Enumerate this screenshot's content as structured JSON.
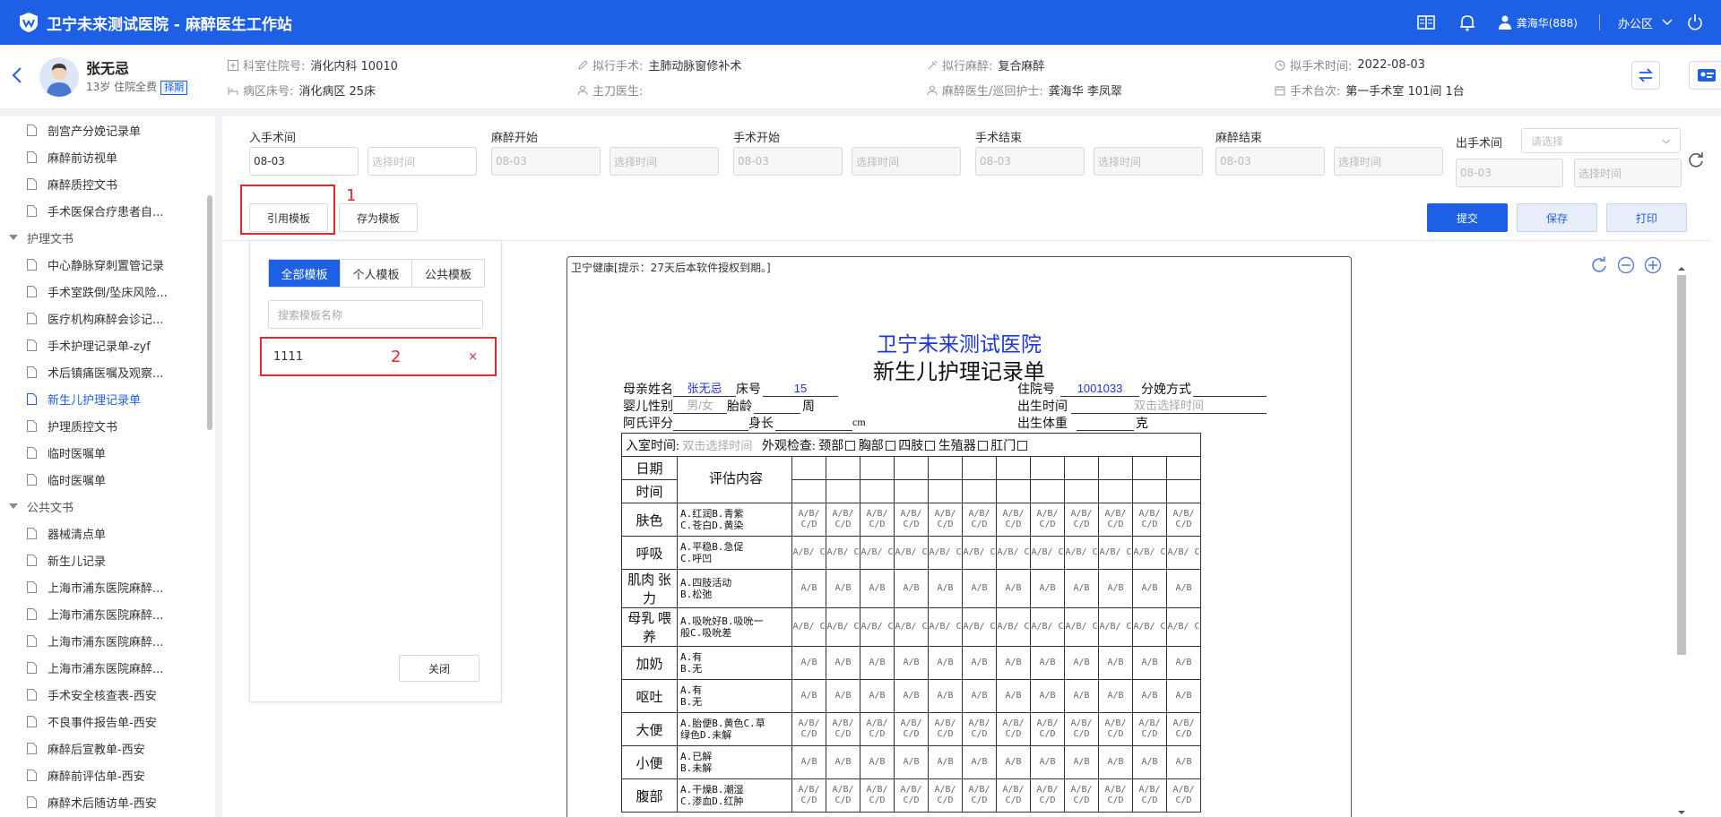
{
  "app": {
    "title": "卫宁未来测试医院 - 麻醉医生工作站",
    "user": "龚海华(888)",
    "office": "办公区"
  },
  "patient": {
    "name": "张无忌",
    "info": "13岁 住院全费",
    "badge": "择期",
    "fields": {
      "ward_no_label": "科室住院号:",
      "ward_no": "消化内科 10010",
      "bed_label": "病区床号:",
      "bed": "消化病区 25床",
      "surgery_label": "拟行手术:",
      "surgery": "主肺动脉窗修补术",
      "surgeon_label": "主刀医生:",
      "surgeon": "",
      "anesthesia_label": "拟行麻醉:",
      "anesthesia": "复合麻醉",
      "anes_doctor_label": "麻醉医生/巡回护士:",
      "anes_doctor": "龚海华 李凤翠",
      "surgery_time_label": "拟手术时间:",
      "surgery_time": "2022-08-03",
      "room_label": "手术台次:",
      "room": "第一手术室 101间 1台"
    }
  },
  "sidebar": {
    "items": [
      {
        "label": "剖宫产分娩记录单",
        "type": "item"
      },
      {
        "label": "麻醉前访视单",
        "type": "item"
      },
      {
        "label": "麻醉质控文书",
        "type": "item"
      },
      {
        "label": "手术医保合疗患者自...",
        "type": "item"
      },
      {
        "label": "护理文书",
        "type": "group"
      },
      {
        "label": "中心静脉穿刺置管记录",
        "type": "item"
      },
      {
        "label": "手术室跌倒/坠床风险...",
        "type": "item"
      },
      {
        "label": "医疗机构麻醉会诊记...",
        "type": "item"
      },
      {
        "label": "手术护理记录单-zyf",
        "type": "item"
      },
      {
        "label": "术后镇痛医嘱及观察...",
        "type": "item"
      },
      {
        "label": "新生儿护理记录单",
        "type": "item",
        "active": true
      },
      {
        "label": "护理质控文书",
        "type": "item"
      },
      {
        "label": "临时医嘱单",
        "type": "item"
      },
      {
        "label": "临时医嘱单",
        "type": "item"
      },
      {
        "label": "公共文书",
        "type": "group"
      },
      {
        "label": "器械清点单",
        "type": "item"
      },
      {
        "label": "新生儿记录",
        "type": "item"
      },
      {
        "label": "上海市浦东医院麻醉...",
        "type": "item"
      },
      {
        "label": "上海市浦东医院麻醉...",
        "type": "item"
      },
      {
        "label": "上海市浦东医院麻醉...",
        "type": "item"
      },
      {
        "label": "上海市浦东医院麻醉...",
        "type": "item"
      },
      {
        "label": "手术安全核查表-西安",
        "type": "item"
      },
      {
        "label": "不良事件报告单-西安",
        "type": "item"
      },
      {
        "label": "麻醉后宣教单-西安",
        "type": "item"
      },
      {
        "label": "麻醉前评估单-西安",
        "type": "item"
      },
      {
        "label": "麻醉术后随访单-西安",
        "type": "item"
      }
    ]
  },
  "times": [
    {
      "label": "入手术间",
      "date": "08-03",
      "time_placeholder": "选择时间",
      "disabled": false
    },
    {
      "label": "麻醉开始",
      "date": "08-03",
      "time_placeholder": "选择时间",
      "disabled": true
    },
    {
      "label": "手术开始",
      "date": "08-03",
      "time_placeholder": "选择时间",
      "disabled": true
    },
    {
      "label": "手术结束",
      "date": "08-03",
      "time_placeholder": "选择时间",
      "disabled": true
    },
    {
      "label": "麻醉结束",
      "date": "08-03",
      "time_placeholder": "选择时间",
      "disabled": true
    }
  ],
  "exit": {
    "label": "出手术间",
    "select_placeholder": "请选择",
    "date": "08-03",
    "time_placeholder": "选择时间"
  },
  "toolbar": {
    "cite_template": "引用模板",
    "save_template": "存为模板",
    "submit": "提交",
    "save": "保存",
    "print": "打印"
  },
  "annotations": {
    "one": "1",
    "two": "2"
  },
  "template_panel": {
    "tabs": [
      "全部模板",
      "个人模板",
      "公共模板"
    ],
    "search_placeholder": "搜索模板名称",
    "items": [
      {
        "name": "1111",
        "remove": "×"
      }
    ],
    "close": "关闭"
  },
  "document": {
    "notice": "卫宁健康[提示：27天后本软件授权到期。]",
    "hospital": "卫宁未来测试医院",
    "form_title": "新生儿护理记录单",
    "mother_label": "母亲姓名",
    "mother": "张无忌",
    "bed_label": "床号",
    "bed": "15",
    "inpatient_label": "住院号",
    "inpatient": "1001033",
    "delivery_label": "分娩方式",
    "sex_label": "婴儿性别",
    "sex": "男/女",
    "gest_label": "胎龄",
    "gest_unit": "周",
    "birth_time_label": "出生时间",
    "birth_time": "双击选择时间",
    "apgar_label": "阿氏评分",
    "length_label": "身长",
    "length_unit": "cm",
    "weight_label": "出生体重",
    "weight_unit": "克",
    "entry_label": "入室时间:",
    "entry": "双击选择时间",
    "exam_label": "外观检查:",
    "exam_items": [
      "颈部",
      "胸部",
      "四肢",
      "生殖器",
      "肛门"
    ],
    "date_label": "日期",
    "time_label": "时间",
    "eval_label": "评估内容",
    "rows": [
      {
        "cat": "肤色",
        "opts": [
          "A.红润B.青紫",
          "C.苍白D.黄染"
        ],
        "val": "A/B/ C/D"
      },
      {
        "cat": "呼吸",
        "opts": [
          "A.平稳B.急促",
          "C.呼凹"
        ],
        "val": "A/B/ C"
      },
      {
        "cat": "肌肉 张力",
        "opts": [
          "A.四肢活动",
          "B.松弛"
        ],
        "val": "A/B"
      },
      {
        "cat": "母乳 喂养",
        "opts": [
          "A.吸吮好B.吸吮一",
          "般C.吸吮差"
        ],
        "val": "A/B/ C"
      },
      {
        "cat": "加奶",
        "opts": [
          "A.有",
          "B.无"
        ],
        "val": "A/B"
      },
      {
        "cat": "呕吐",
        "opts": [
          "A.有",
          "B.无"
        ],
        "val": "A/B"
      },
      {
        "cat": "大便",
        "opts": [
          "A.胎便B.黄色C.草",
          "绿色D.未解"
        ],
        "val": "A/B/ C/D"
      },
      {
        "cat": "小便",
        "opts": [
          "A.已解",
          "B.未解"
        ],
        "val": "A/B"
      },
      {
        "cat": "腹部",
        "opts": [
          "A.干燥B.潮湿",
          "C.渗血D.红肿"
        ],
        "val": "A/B/ C/D"
      }
    ]
  }
}
